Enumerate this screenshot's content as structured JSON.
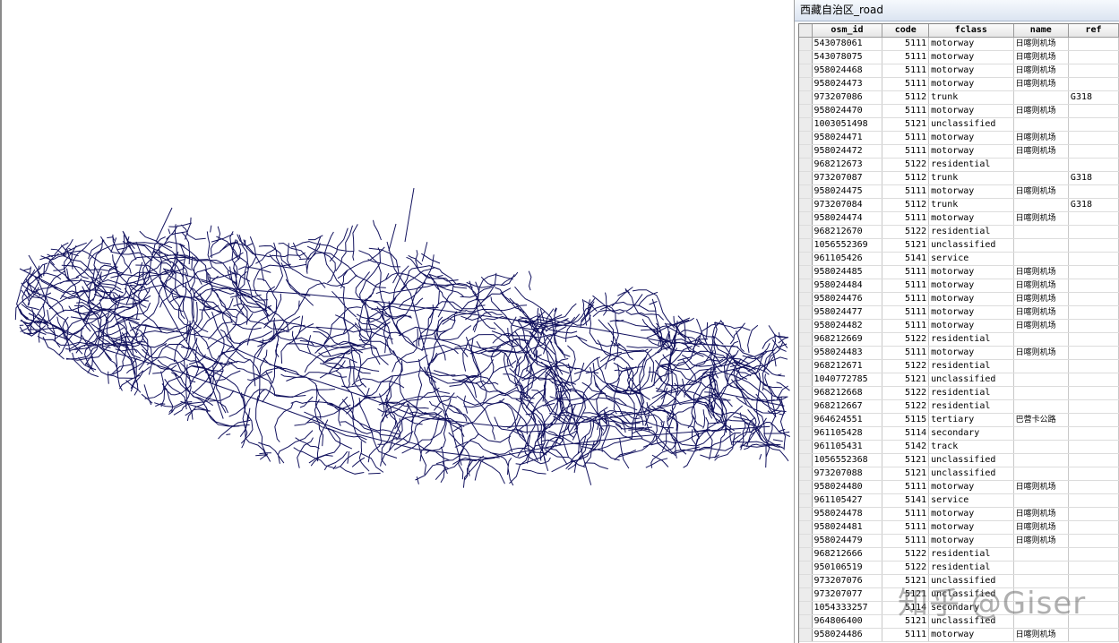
{
  "window": {
    "title": "西藏自治区_road"
  },
  "map": {
    "line_color": "#12125e",
    "background": "#ffffff"
  },
  "table": {
    "columns": [
      "osm_id",
      "code",
      "fclass",
      "name",
      "ref"
    ],
    "rows": [
      [
        "543078061",
        "5111",
        "motorway",
        "日喀则机场",
        ""
      ],
      [
        "543078075",
        "5111",
        "motorway",
        "日喀则机场",
        ""
      ],
      [
        "958024468",
        "5111",
        "motorway",
        "日喀则机场",
        ""
      ],
      [
        "958024473",
        "5111",
        "motorway",
        "日喀则机场",
        ""
      ],
      [
        "973207086",
        "5112",
        "trunk",
        "",
        "G318"
      ],
      [
        "958024470",
        "5111",
        "motorway",
        "日喀则机场",
        ""
      ],
      [
        "1003051498",
        "5121",
        "unclassified",
        "",
        ""
      ],
      [
        "958024471",
        "5111",
        "motorway",
        "日喀则机场",
        ""
      ],
      [
        "958024472",
        "5111",
        "motorway",
        "日喀则机场",
        ""
      ],
      [
        "968212673",
        "5122",
        "residential",
        "",
        ""
      ],
      [
        "973207087",
        "5112",
        "trunk",
        "",
        "G318"
      ],
      [
        "958024475",
        "5111",
        "motorway",
        "日喀则机场",
        ""
      ],
      [
        "973207084",
        "5112",
        "trunk",
        "",
        "G318"
      ],
      [
        "958024474",
        "5111",
        "motorway",
        "日喀则机场",
        ""
      ],
      [
        "968212670",
        "5122",
        "residential",
        "",
        ""
      ],
      [
        "1056552369",
        "5121",
        "unclassified",
        "",
        ""
      ],
      [
        "961105426",
        "5141",
        "service",
        "",
        ""
      ],
      [
        "958024485",
        "5111",
        "motorway",
        "日喀则机场",
        ""
      ],
      [
        "958024484",
        "5111",
        "motorway",
        "日喀则机场",
        ""
      ],
      [
        "958024476",
        "5111",
        "motorway",
        "日喀则机场",
        ""
      ],
      [
        "958024477",
        "5111",
        "motorway",
        "日喀则机场",
        ""
      ],
      [
        "958024482",
        "5111",
        "motorway",
        "日喀则机场",
        ""
      ],
      [
        "968212669",
        "5122",
        "residential",
        "",
        ""
      ],
      [
        "958024483",
        "5111",
        "motorway",
        "日喀则机场",
        ""
      ],
      [
        "968212671",
        "5122",
        "residential",
        "",
        ""
      ],
      [
        "1040772785",
        "5121",
        "unclassified",
        "",
        ""
      ],
      [
        "968212668",
        "5122",
        "residential",
        "",
        ""
      ],
      [
        "968212667",
        "5122",
        "residential",
        "",
        ""
      ],
      [
        "964624551",
        "5115",
        "tertiary",
        "巴营卡公路",
        ""
      ],
      [
        "961105428",
        "5114",
        "secondary",
        "",
        ""
      ],
      [
        "961105431",
        "5142",
        "track",
        "",
        ""
      ],
      [
        "1056552368",
        "5121",
        "unclassified",
        "",
        ""
      ],
      [
        "973207088",
        "5121",
        "unclassified",
        "",
        ""
      ],
      [
        "958024480",
        "5111",
        "motorway",
        "日喀则机场",
        ""
      ],
      [
        "961105427",
        "5141",
        "service",
        "",
        ""
      ],
      [
        "958024478",
        "5111",
        "motorway",
        "日喀则机场",
        ""
      ],
      [
        "958024481",
        "5111",
        "motorway",
        "日喀则机场",
        ""
      ],
      [
        "958024479",
        "5111",
        "motorway",
        "日喀则机场",
        ""
      ],
      [
        "968212666",
        "5122",
        "residential",
        "",
        ""
      ],
      [
        "950106519",
        "5122",
        "residential",
        "",
        ""
      ],
      [
        "973207076",
        "5121",
        "unclassified",
        "",
        ""
      ],
      [
        "973207077",
        "5121",
        "unclassified",
        "",
        ""
      ],
      [
        "1054333257",
        "5114",
        "secondary",
        "",
        ""
      ],
      [
        "964806400",
        "5121",
        "unclassified",
        "",
        ""
      ],
      [
        "958024486",
        "5111",
        "motorway",
        "日喀则机场",
        ""
      ]
    ]
  },
  "watermark": "知乎 @Giser"
}
